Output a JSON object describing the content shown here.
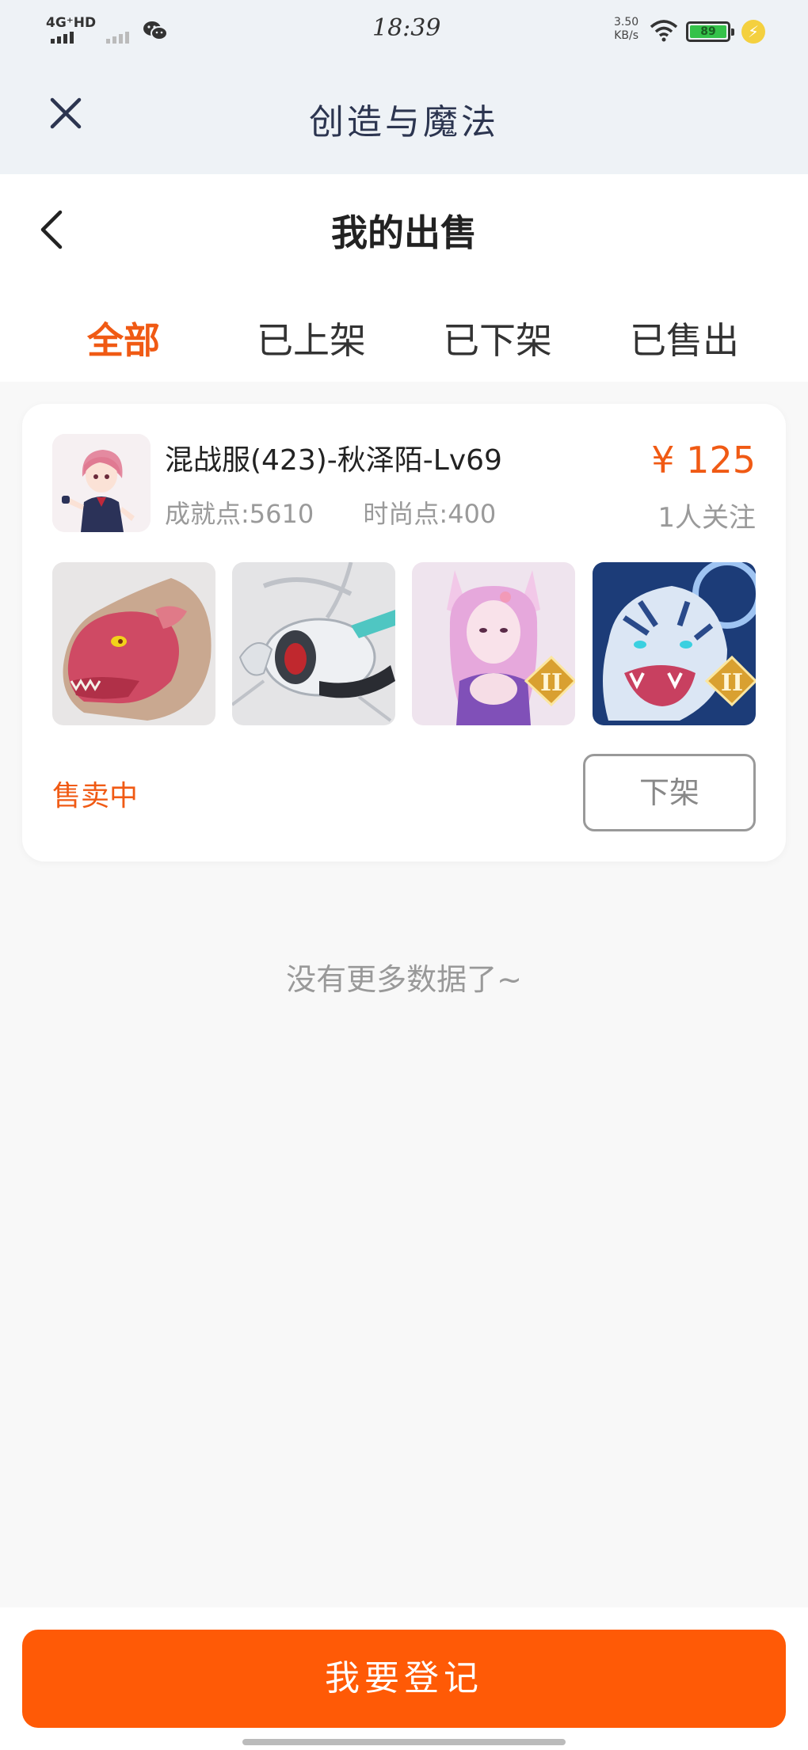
{
  "status_bar": {
    "network": "4G⁺HD",
    "time": "18:39",
    "speed_value": "3.50",
    "speed_unit": "KB/s",
    "battery": "89"
  },
  "webview": {
    "title": "创造与魔法"
  },
  "header": {
    "title": "我的出售"
  },
  "tabs": [
    {
      "label": "全部",
      "active": true
    },
    {
      "label": "已上架",
      "active": false
    },
    {
      "label": "已下架",
      "active": false
    },
    {
      "label": "已售出",
      "active": false
    }
  ],
  "listing": {
    "title": "混战服(423)-秋泽陌-Lv69",
    "achievement": "成就点:5610",
    "fashion": "时尚点:400",
    "price": "¥ 125",
    "followers": "1人关注",
    "status": "售卖中",
    "delist_label": "下架",
    "thumbnails": [
      {
        "name": "dragon-mount",
        "badge": ""
      },
      {
        "name": "mecha-mount",
        "badge": ""
      },
      {
        "name": "fox-girl-skin",
        "badge": "II"
      },
      {
        "name": "ice-tiger-mount",
        "badge": "II"
      }
    ]
  },
  "empty_text": "没有更多数据了~",
  "footer": {
    "register_label": "我要登记"
  },
  "colors": {
    "accent": "#f05a14",
    "button": "#ff5a06",
    "header_bg": "#eef2f6"
  }
}
